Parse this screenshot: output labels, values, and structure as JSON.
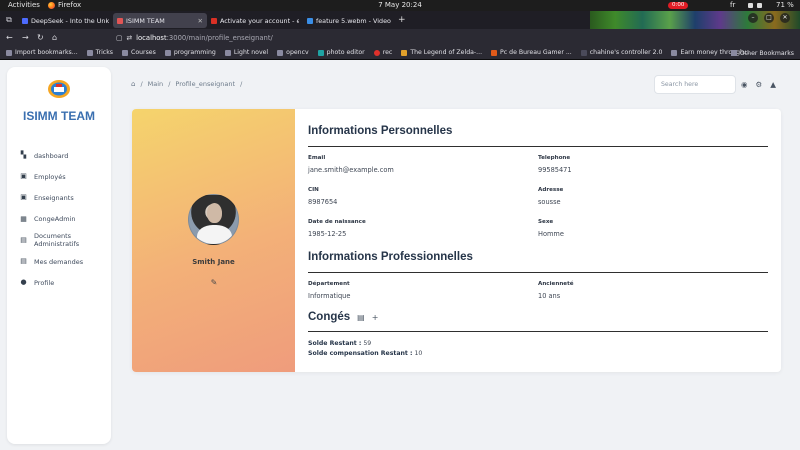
{
  "gnome": {
    "activities": "Activities",
    "app": "Firefox",
    "clock": "7 May  20:24",
    "recording": "0:00",
    "lang": "fr",
    "battery": "71 %"
  },
  "tabs": [
    {
      "title": "DeepSeek - Into the Unkn",
      "active": false,
      "color": "#4d6bfe"
    },
    {
      "title": "ISIMM TEAM",
      "active": true,
      "color": "#e25555"
    },
    {
      "title": "Activate your account - e",
      "active": false,
      "color": "#d93025"
    },
    {
      "title": "feature 5.webm - Video",
      "active": false,
      "color": "#3a8ee6"
    }
  ],
  "url": {
    "host": "localhost",
    "path": ":3000/main/profile_enseignant/"
  },
  "bookmarks": [
    {
      "label": "Import bookmarks...",
      "color": "#8a8aa0"
    },
    {
      "label": "Tricks",
      "color": "#8a8aa0"
    },
    {
      "label": "Courses",
      "color": "#8a8aa0"
    },
    {
      "label": "programming",
      "color": "#8a8aa0"
    },
    {
      "label": "Light novel",
      "color": "#8a8aa0"
    },
    {
      "label": "opencv",
      "color": "#8a8aa0"
    },
    {
      "label": "photo editor",
      "color": "#1fa3a3"
    },
    {
      "label": "rec",
      "color": "#e0312b"
    },
    {
      "label": "The Legend of Zelda-...",
      "color": "#e0a02b"
    },
    {
      "label": "Pc de Bureau Gamer ...",
      "color": "#e05a1a"
    },
    {
      "label": "chahine's controller 2.0",
      "color": "#4a4a5a"
    },
    {
      "label": "Earn money through...",
      "color": "#8a8aa0"
    }
  ],
  "bookmarks_other": "Other Bookmarks",
  "sidebar": {
    "brand": "ISIMM TEAM",
    "items": [
      {
        "label": "dashboard",
        "icon": "dashboard-icon",
        "glyph": "▚"
      },
      {
        "label": "Employés",
        "icon": "employees-icon",
        "glyph": "▣"
      },
      {
        "label": "Enseignants",
        "icon": "teachers-icon",
        "glyph": "▣"
      },
      {
        "label": "CongeAdmin",
        "icon": "calendar-icon",
        "glyph": "▦"
      },
      {
        "label": "Documents Administratifs",
        "icon": "document-icon",
        "glyph": "▤"
      },
      {
        "label": "Mes demandes",
        "icon": "requests-icon",
        "glyph": "▤"
      },
      {
        "label": "Profile",
        "icon": "profile-icon",
        "glyph": "●"
      }
    ]
  },
  "breadcrumb": [
    "Main",
    "Profile_enseignant"
  ],
  "search": {
    "placeholder": "Search here"
  },
  "profile": {
    "name": "Smith Jane"
  },
  "personal": {
    "title": "Informations Personnelles",
    "fields": [
      {
        "label": "Email",
        "value": "jane.smith@example.com"
      },
      {
        "label": "Telephone",
        "value": "99585471"
      },
      {
        "label": "CIN",
        "value": "8987654"
      },
      {
        "label": "Adresse",
        "value": "sousse"
      },
      {
        "label": "Date de naissance",
        "value": "1985-12-25"
      },
      {
        "label": "Sexe",
        "value": "Homme"
      }
    ]
  },
  "professional": {
    "title": "Informations Professionnelles",
    "fields": [
      {
        "label": "Département",
        "value": "Informatique"
      },
      {
        "label": "Ancienneté",
        "value": "10 ans"
      }
    ]
  },
  "conges": {
    "title": "Congés",
    "solde_label": "Solde Restant :",
    "solde_value": "59",
    "comp_label": "Solde compensation Restant :",
    "comp_value": "10"
  }
}
